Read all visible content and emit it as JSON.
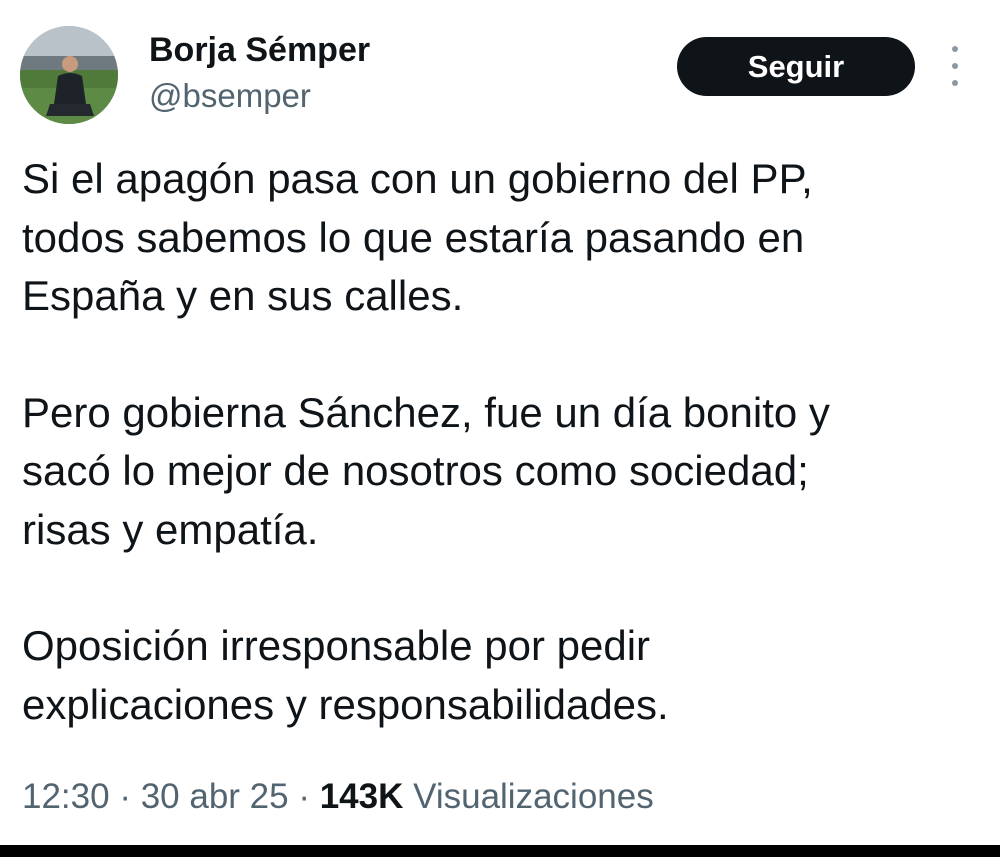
{
  "author": {
    "display_name": "Borja Sémper",
    "handle": "@bsemper"
  },
  "follow_button": {
    "label": "Seguir"
  },
  "more_icon": "more-vertical-icon",
  "tweet": {
    "paragraphs": [
      "Si el apagón pasa con un gobierno del PP,\ntodos sabemos lo que estaría pasando en\nEspaña y en sus calles.",
      "Pero gobierna Sánchez, fue un día bonito y\nsacó lo mejor de nosotros como sociedad;\nrisas y empatía.",
      "Oposición irresponsable por pedir\nexplicaciones y responsabilidades."
    ]
  },
  "meta": {
    "time": "12:30",
    "separator": " · ",
    "date": "30 abr 25",
    "views_count": "143K",
    "views_label": " Visualizaciones"
  },
  "colors": {
    "text": "#0f1419",
    "secondary_text": "#536471",
    "button_bg": "#0f1419",
    "button_text": "#ffffff"
  }
}
